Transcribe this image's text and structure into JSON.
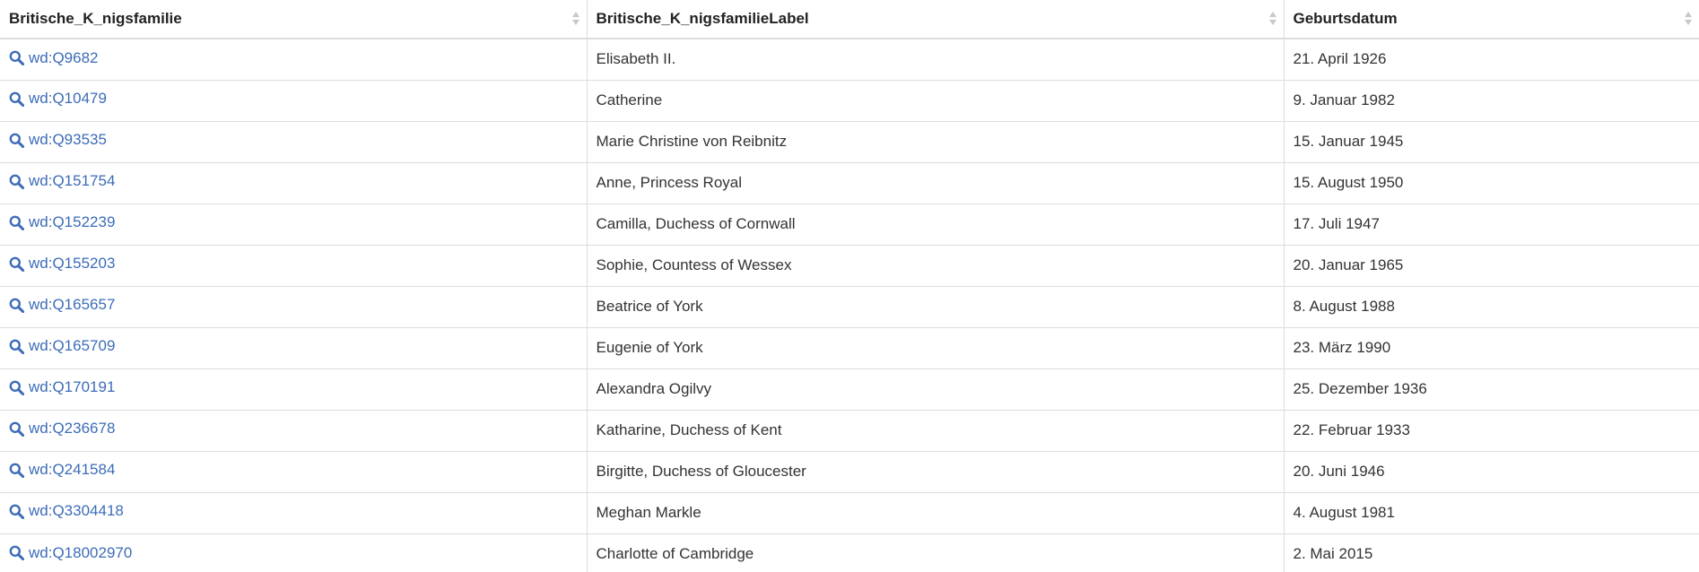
{
  "table": {
    "columns": [
      "Britische_K_nigsfamilie",
      "Britische_K_nigsfamilieLabel",
      "Geburtsdatum"
    ],
    "icons": {
      "item_icon": "search-icon",
      "sort_icon": "sort-icon"
    },
    "colors": {
      "link": "#3d6cb8",
      "border": "#dddddd"
    },
    "rows": [
      {
        "id": "wd:Q9682",
        "label": "Elisabeth II.",
        "birth": "21. April 1926"
      },
      {
        "id": "wd:Q10479",
        "label": "Catherine",
        "birth": "9. Januar 1982"
      },
      {
        "id": "wd:Q93535",
        "label": "Marie Christine von Reibnitz",
        "birth": "15. Januar 1945"
      },
      {
        "id": "wd:Q151754",
        "label": "Anne, Princess Royal",
        "birth": "15. August 1950"
      },
      {
        "id": "wd:Q152239",
        "label": "Camilla, Duchess of Cornwall",
        "birth": "17. Juli 1947"
      },
      {
        "id": "wd:Q155203",
        "label": "Sophie, Countess of Wessex",
        "birth": "20. Januar 1965"
      },
      {
        "id": "wd:Q165657",
        "label": "Beatrice of York",
        "birth": "8. August 1988"
      },
      {
        "id": "wd:Q165709",
        "label": "Eugenie of York",
        "birth": "23. März 1990"
      },
      {
        "id": "wd:Q170191",
        "label": "Alexandra Ogilvy",
        "birth": "25. Dezember 1936"
      },
      {
        "id": "wd:Q236678",
        "label": "Katharine, Duchess of Kent",
        "birth": "22. Februar 1933"
      },
      {
        "id": "wd:Q241584",
        "label": "Birgitte, Duchess of Gloucester",
        "birth": "20. Juni 1946"
      },
      {
        "id": "wd:Q3304418",
        "label": "Meghan Markle",
        "birth": "4. August 1981"
      },
      {
        "id": "wd:Q18002970",
        "label": "Charlotte of Cambridge",
        "birth": "2. Mai 2015"
      }
    ]
  }
}
